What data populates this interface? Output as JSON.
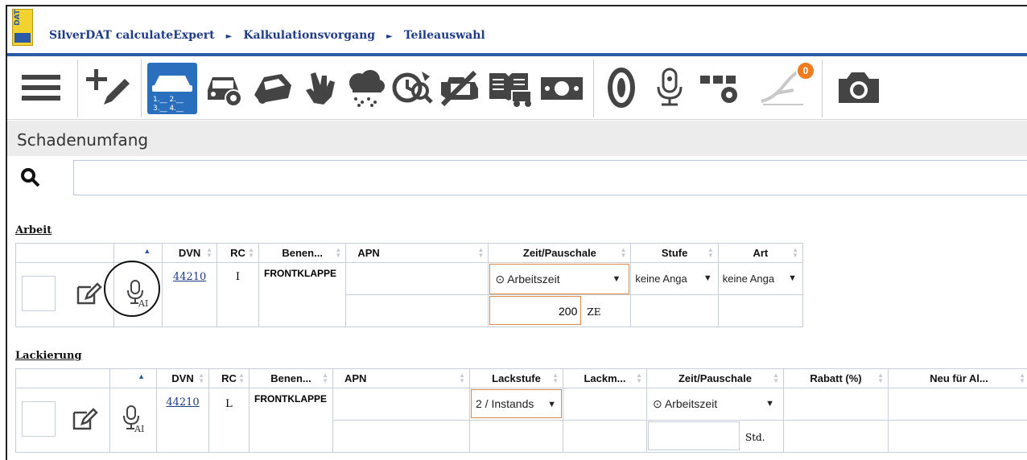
{
  "breadcrumb": [
    "SilverDAT calculateExpert",
    "Kalkulationsvorgang",
    "Teileauswahl"
  ],
  "logo_text": "DAT",
  "toolbar": {
    "icons": [
      "menu-icon",
      "add-edit-icon",
      "vehicle-selection-icon",
      "car-settings-icon",
      "car-damage-icon",
      "hand-icon",
      "weather-icon",
      "search-timer-icon",
      "engine-warning-icon",
      "manual-truck-icon",
      "money-icon",
      "tire-icon",
      "microphone-icon",
      "modules-settings-icon",
      "signature-icon",
      "camera-icon"
    ],
    "badge": "0",
    "vehicle_nums": "1.__ 2.__ 3.__ 4.__"
  },
  "section_title": "Schadenumfang",
  "search": {
    "placeholder": ""
  },
  "arbeit": {
    "title": "Arbeit",
    "headers": [
      "",
      "",
      "DVN",
      "RC",
      "Benen...",
      "APN",
      "Zeit/Pauschale",
      "Stufe",
      "Art"
    ],
    "row": {
      "dvn": "44210",
      "rc": "I",
      "benennung": "FRONTKLAPPE",
      "apn": "",
      "zeit_select": "⊙ Arbeitszeit",
      "stufe_select": "keine Anga",
      "art_select": "keine Anga",
      "zeit_value": "200",
      "zeit_unit": "ZE",
      "ai_label": "AI"
    }
  },
  "lackierung": {
    "title": "Lackierung",
    "headers": [
      "",
      "",
      "DVN",
      "RC",
      "Benen...",
      "APN",
      "Lackstufe",
      "Lackm...",
      "Zeit/Pauschale",
      "Rabatt (%)",
      "Neu für Al..."
    ],
    "row": {
      "dvn": "44210",
      "rc": "L",
      "benennung": "FRONTKLAPPE",
      "apn": "",
      "lackstufe_select": "2 / Instands",
      "zeit_select": "⊙ Arbeitszeit",
      "zeit_value": "",
      "zeit_unit": "Std.",
      "ai_label": "AI"
    }
  },
  "colors": {
    "brand_blue": "#2a5aa8",
    "accent_orange": "#f07b21",
    "highlight_border": "#e08a4a"
  }
}
